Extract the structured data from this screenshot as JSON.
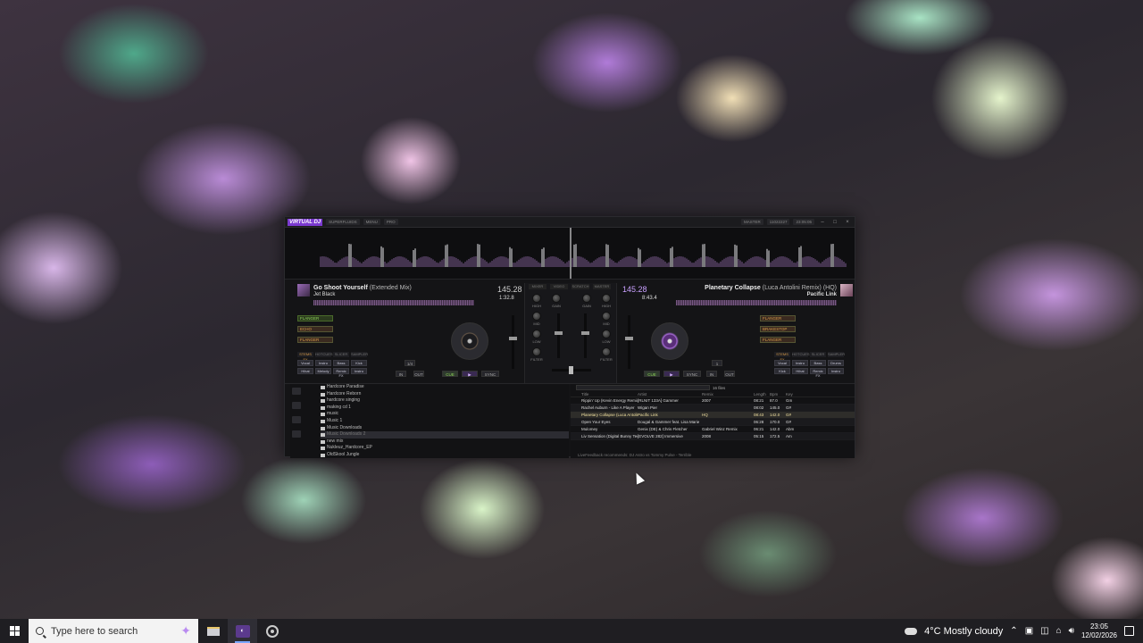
{
  "window": {
    "app_name": "VIRTUAL DJ",
    "preset_btn": "SUPERFLUIDS",
    "skin_label": "MENU",
    "skin_value": "PRO",
    "master_label": "MASTER",
    "master_value": "11022227",
    "clock": "23:05:05"
  },
  "deck_left": {
    "title": "Go Shoot Yourself",
    "remix": "(Extended Mix)",
    "artist": "Jet Black",
    "bpm": "145.28",
    "time": "1:32.8",
    "fx": [
      "FLANGER",
      "ECHO",
      "FLANGER"
    ],
    "pad_tabs": [
      "STEMS FX",
      "HOTCUES",
      "SLICER",
      "SAMPLER"
    ],
    "pads": [
      "Vocal",
      "Instru",
      "Bass",
      "Kick",
      "Hihat",
      "Melody",
      "Remix FX",
      "Instru"
    ],
    "loop": "1/4",
    "btn_in": "IN",
    "btn_out": "OUT",
    "btn_cue": "CUE",
    "btn_play": "▶",
    "btn_sync": "SYNC"
  },
  "deck_right": {
    "title": "Planetary Collapse",
    "remix": "(Luca Antolini Remix) (HQ)",
    "artist": "Pacific Link",
    "bpm": "145.28",
    "time": "8:43.4",
    "fx": [
      "FLANGER",
      "BRAKESTOP",
      "FLANGER"
    ],
    "pad_tabs": [
      "STEMS FX",
      "HOTCUES",
      "SLICER",
      "SAMPLER"
    ],
    "pads": [
      "Vocal",
      "Instru",
      "Bass",
      "Drums",
      "Kick",
      "Hihat",
      "Remix FX",
      "Instru"
    ],
    "loop": "1",
    "btn_in": "IN",
    "btn_out": "OUT",
    "btn_cue": "CUE",
    "btn_play": "▶",
    "btn_sync": "SYNC"
  },
  "mixer": {
    "tabs": [
      "MIXER",
      "VIDEO",
      "SCRATCH",
      "MASTER"
    ],
    "labels": [
      "HIGH",
      "GAIN",
      "GAIN",
      "HIGH",
      "MID",
      "MID",
      "LOW",
      "LOW",
      "FILTER",
      "FILTER"
    ]
  },
  "browser": {
    "folders": [
      "Hardcore Paradise",
      "Hardcore Reborn",
      "hardcore singing",
      "making cd 1",
      "music",
      "Music 1",
      "Music Downloads",
      "Music Downloads 2",
      "new mix",
      "Nukleuz_Hardcore_EP",
      "OldSkool Jungle"
    ],
    "selected_folder": "Music Downloads 2",
    "file_count": "16 files",
    "headers": {
      "title": "Title",
      "artist": "Artist",
      "remix": "Remix",
      "length": "Length",
      "bpm": "Bpm",
      "key": "Key"
    },
    "rows": [
      {
        "title": "Rippin' Up (Kevin Energy Remix)",
        "artist": "[RLNIT 133A] Gammer",
        "remix": "2007",
        "length": "08:21",
        "bpm": "87.0",
        "key": "Gm"
      },
      {
        "title": "Rachel Auburn - Like A Player",
        "artist": "Wigan Pier",
        "remix": "",
        "length": "08:02",
        "bpm": "145.0",
        "key": "G#"
      },
      {
        "title": "Planetary Collapse (Luca Antolini Remix)",
        "artist": "Pacific Link",
        "remix": "HQ",
        "length": "08:43",
        "bpm": "142.0",
        "key": "G#"
      },
      {
        "title": "Open Your Eyes",
        "artist": "Dougal & Gammer feat. Lisa Marie",
        "remix": "",
        "length": "06:28",
        "bpm": "170.0",
        "key": "G#"
      },
      {
        "title": "Mulomey",
        "artist": "Genix (DE) & Chris Fletcher",
        "remix": "Gabriel Winz Remix",
        "length": "06:21",
        "bpm": "142.0",
        "key": "Abm"
      },
      {
        "title": "Liv Sensation (Digital Bunny Techno Mix)",
        "artist": "[EVOLVE 282] Immersive",
        "remix": "2008",
        "length": "05:15",
        "bpm": "172.5",
        "key": "Am"
      }
    ],
    "info_line": "LiveFeedback recommends: DJ Astro vs Tommy Pulse - Terrible"
  },
  "taskbar": {
    "search_placeholder": "Type here to search",
    "weather": "4°C  Mostly cloudy",
    "time": "23:05",
    "date": "12/02/2026"
  },
  "colors": {
    "accent_purple": "#7b3ad0",
    "deck_bpm": "#c9a0ff",
    "fx_orange": "#d79a4a",
    "fx_green": "#8fd35a"
  }
}
